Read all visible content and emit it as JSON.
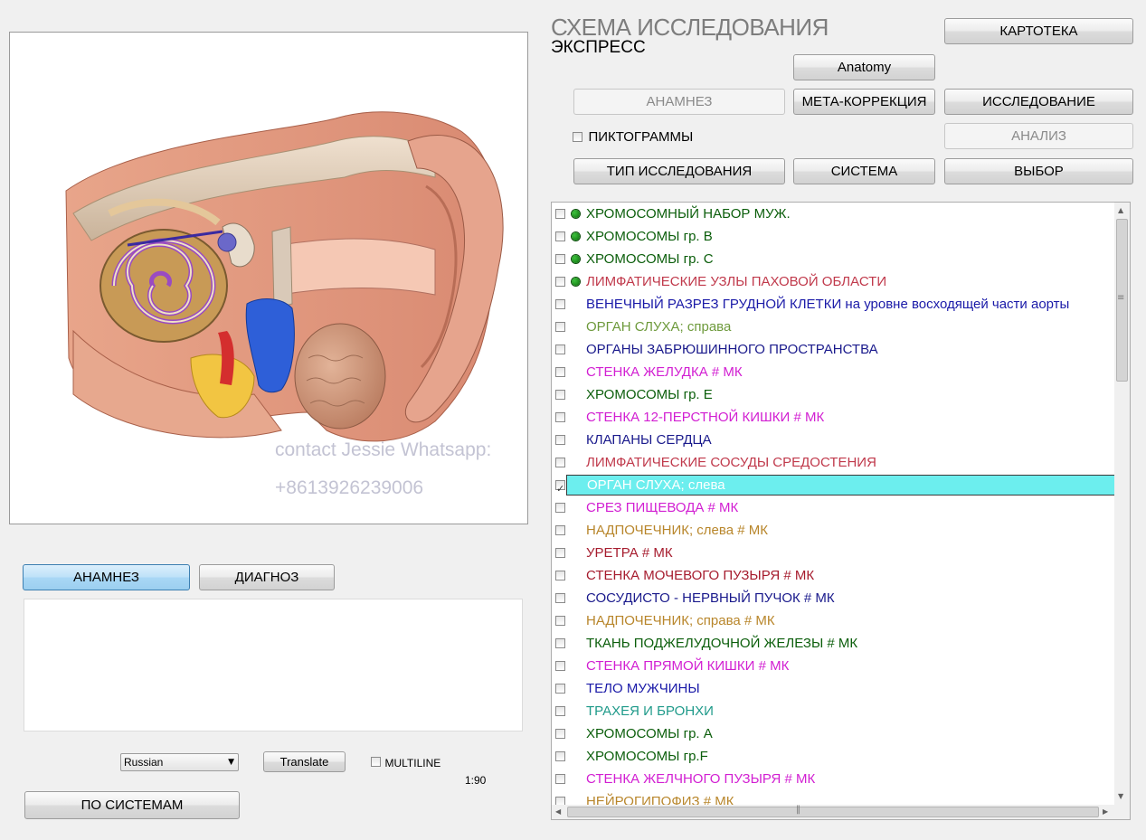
{
  "header": {
    "title": "СХЕМА ИССЛЕДОВАНИЯ",
    "subtitle": "ЭКСПРЕСС"
  },
  "buttons": {
    "cardfile": "КАРТОТЕКА",
    "anatomy": "Anatomy",
    "anamnesis_top": "АНАМНЕЗ",
    "meta_correction": "МЕТА-КОРРЕКЦИЯ",
    "research": "ИССЛЕДОВАНИЕ",
    "analysis": "АНАЛИЗ",
    "research_type": "ТИП ИССЛЕДОВАНИЯ",
    "system": "СИСТЕМА",
    "choice": "ВЫБОР",
    "anamnesis_tab": "АНАМНЕЗ",
    "diagnosis_tab": "ДИАГНОЗ",
    "translate": "Translate",
    "by_systems": "ПО СИСТЕМАМ"
  },
  "pictograms": {
    "label": "ПИКТОГРАММЫ",
    "checked": false
  },
  "multiline": {
    "label": "MULTILINE",
    "checked": false
  },
  "language": {
    "selected": "Russian"
  },
  "counter": "1:90",
  "watermark": {
    "line1": "contact Jessie Whatsapp:",
    "line2": "+8613926239006"
  },
  "image": {
    "subject": "ear anatomy cross-section illustration"
  },
  "list": {
    "items": [
      {
        "text": "ХРОМОСОМНЫЙ  НАБОР  МУЖ.",
        "color": "#0b5e0b",
        "dot": true,
        "checked": false,
        "selected": false
      },
      {
        "text": "ХРОМОСОМЫ  гр.  В",
        "color": "#0b5e0b",
        "dot": true,
        "checked": false,
        "selected": false
      },
      {
        "text": "ХРОМОСОМЫ  гр.  С",
        "color": "#0b5e0b",
        "dot": true,
        "checked": false,
        "selected": false
      },
      {
        "text": "ЛИМФАТИЧЕСКИЕ УЗЛЫ ПАХОВОЙ ОБЛАСТИ",
        "color": "#c0394b",
        "dot": true,
        "checked": false,
        "selected": false
      },
      {
        "text": "ВЕНЕЧНЫЙ РАЗРЕЗ ГРУДНОЙ КЛЕТКИ на уровне восходящей части аорты",
        "color": "#1a1aa8",
        "dot": false,
        "checked": false,
        "selected": false
      },
      {
        "text": "ОРГАН  СЛУХА;  справа",
        "color": "#6e9a3c",
        "dot": false,
        "checked": false,
        "selected": false
      },
      {
        "text": "ОРГАНЫ ЗАБРЮШИННОГО ПРОСТРАНСТВА",
        "color": "#1a1a8c",
        "dot": false,
        "checked": false,
        "selected": false
      },
      {
        "text": "СТЕНКА  ЖЕЛУДКА # МК",
        "color": "#d21fd2",
        "dot": false,
        "checked": false,
        "selected": false
      },
      {
        "text": "ХРОМОСОМЫ  гр. Е",
        "color": "#0b5e0b",
        "dot": false,
        "checked": false,
        "selected": false
      },
      {
        "text": "СТЕНКА  12-ПЕРСТНОЙ  КИШКИ # МК",
        "color": "#d21fd2",
        "dot": false,
        "checked": false,
        "selected": false
      },
      {
        "text": "КЛАПАНЫ  СЕРДЦА",
        "color": "#1a1a8c",
        "dot": false,
        "checked": false,
        "selected": false
      },
      {
        "text": "ЛИМФАТИЧЕСКИЕ СОСУДЫ СРЕДОСТЕНИЯ",
        "color": "#c0394b",
        "dot": false,
        "checked": false,
        "selected": false
      },
      {
        "text": "ОРГАН  СЛУХА;  слева",
        "color": "#ffffff",
        "dot": false,
        "checked": true,
        "selected": true
      },
      {
        "text": "СРЕЗ  ПИЩЕВОДА # МК",
        "color": "#d21fd2",
        "dot": false,
        "checked": false,
        "selected": false
      },
      {
        "text": "НАДПОЧЕЧНИК;  слева # МК",
        "color": "#b8862b",
        "dot": false,
        "checked": false,
        "selected": false
      },
      {
        "text": "УРЕТРА # МК",
        "color": "#a61c2e",
        "dot": false,
        "checked": false,
        "selected": false
      },
      {
        "text": "СТЕНКА  МОЧЕВОГО  ПУЗЫРЯ # МК",
        "color": "#a61c2e",
        "dot": false,
        "checked": false,
        "selected": false
      },
      {
        "text": "СОСУДИСТО - НЕРВНЫЙ  ПУЧОК #  МК",
        "color": "#1a1a8c",
        "dot": false,
        "checked": false,
        "selected": false
      },
      {
        "text": "НАДПОЧЕЧНИК;  справа # МК",
        "color": "#b8862b",
        "dot": false,
        "checked": false,
        "selected": false
      },
      {
        "text": "ТКАНЬ  ПОДЖЕЛУДОЧНОЙ  ЖЕЛЕЗЫ # МК",
        "color": "#0b5e0b",
        "dot": false,
        "checked": false,
        "selected": false
      },
      {
        "text": "СТЕНКА  ПРЯМОЙ  КИШКИ # МК",
        "color": "#d21fd2",
        "dot": false,
        "checked": false,
        "selected": false
      },
      {
        "text": "ТЕЛО  МУЖЧИНЫ",
        "color": "#1a1aa8",
        "dot": false,
        "checked": false,
        "selected": false
      },
      {
        "text": "ТРАХЕЯ И БРОНХИ",
        "color": "#1f9a8a",
        "dot": false,
        "checked": false,
        "selected": false
      },
      {
        "text": "ХРОМОСОМЫ  гр.  А",
        "color": "#0b5e0b",
        "dot": false,
        "checked": false,
        "selected": false
      },
      {
        "text": "ХРОМОСОМЫ  гр.F",
        "color": "#0b5e0b",
        "dot": false,
        "checked": false,
        "selected": false
      },
      {
        "text": "СТЕНКА  ЖЕЛЧНОГО  ПУЗЫРЯ # МК",
        "color": "#d21fd2",
        "dot": false,
        "checked": false,
        "selected": false
      },
      {
        "text": "НЕЙРОГИПОФИЗ # МК",
        "color": "#b8862b",
        "dot": false,
        "checked": false,
        "selected": false
      }
    ]
  }
}
